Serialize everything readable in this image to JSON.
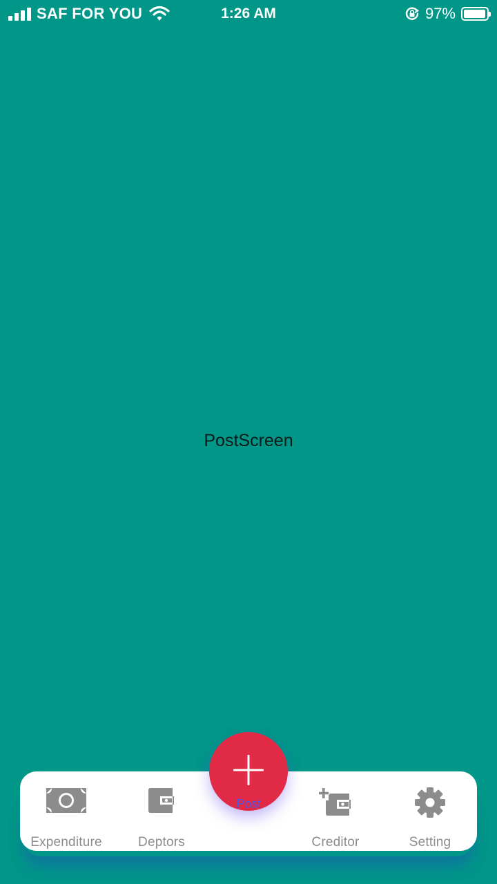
{
  "status_bar": {
    "carrier": "SAF FOR YOU",
    "time": "1:26 AM",
    "battery_percent": "97%",
    "battery_level": 0.97,
    "icons": [
      "signal-icon",
      "wifi-icon",
      "orientation-lock-icon",
      "battery-icon"
    ]
  },
  "screen": {
    "label": "PostScreen",
    "background_color": "#009688"
  },
  "tab_bar": {
    "tabs": [
      {
        "label": "Expenditure",
        "icon": "money-icon"
      },
      {
        "label": "Deptors",
        "icon": "wallet-icon"
      },
      {
        "label": "Post",
        "icon": "plus-icon",
        "active": true
      },
      {
        "label": "Creditor",
        "icon": "add-wallet-icon"
      },
      {
        "label": "Setting",
        "icon": "gear-icon"
      }
    ],
    "inactive_color": "#8c8c8c",
    "active_color": "#4b57e6",
    "post_button_color": "#e12a46"
  }
}
